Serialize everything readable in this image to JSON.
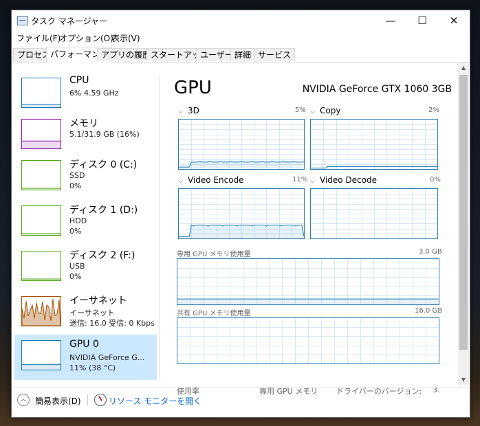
{
  "window": {
    "title": "タスク マネージャー",
    "minimize_glyph": "—",
    "maximize_glyph": "☐",
    "close_glyph": "✕"
  },
  "menu": [
    "ファイル(F)",
    "オプション(O)",
    "表示(V)"
  ],
  "tabs": [
    {
      "label": "プロセス"
    },
    {
      "label": "パフォーマンス",
      "active": true
    },
    {
      "label": "アプリの履歴"
    },
    {
      "label": "スタートアップ"
    },
    {
      "label": "ユーザー"
    },
    {
      "label": "詳細"
    },
    {
      "label": "サービス"
    }
  ],
  "sidebar": [
    {
      "name": "CPU",
      "line1": "6% 4.59 GHz",
      "color": "#1179b8",
      "level": 0.06
    },
    {
      "name": "メモリ",
      "line1": "5.1/31.9 GB (16%)",
      "color": "#8b12ae",
      "level": 0.16
    },
    {
      "name": "ディスク 0 (C:)",
      "line1": "SSD",
      "line2": "0%",
      "color": "#4da60c",
      "level": 0
    },
    {
      "name": "ディスク 1 (D:)",
      "line1": "HDD",
      "line2": "0%",
      "color": "#4da60c",
      "level": 0
    },
    {
      "name": "ディスク 2 (F:)",
      "line1": "USB",
      "line2": "0%",
      "color": "#4da60c",
      "level": 0
    },
    {
      "name": "イーサネット",
      "line1": "イーサネット",
      "line2": "送信: 16.0 受信: 0 Kbps",
      "color": "#a74f01"
    },
    {
      "name": "GPU 0",
      "line1": "NVIDIA GeForce G...",
      "line2": "11% (38 °C)",
      "color": "#1179b8",
      "level": 0.11,
      "selected": true
    }
  ],
  "main": {
    "title": "GPU",
    "model": "NVIDIA GeForce GTX 1060 3GB",
    "engines": [
      {
        "label": "3D",
        "pct": "5%"
      },
      {
        "label": "Copy",
        "pct": "2%"
      },
      {
        "label": "Video Encode",
        "pct": "11%"
      },
      {
        "label": "Video Decode",
        "pct": "0%"
      }
    ],
    "dedicated_label": "専用 GPU メモリ使用量",
    "dedicated_max": "3.0 GB",
    "shared_label": "共有 GPU メモリ使用量",
    "shared_max": "16.0 GB",
    "bottom_stats": [
      "使用率",
      "専用 GPU メモリ",
      "ドライバーのバージョン:",
      "3."
    ]
  },
  "footer": {
    "fewer_details": "簡易表示(D)",
    "resource_monitor": "リソース モニターを開く"
  },
  "colors": {
    "accent": "#1179b8",
    "grid": "#d6e8f4",
    "selected": "#cce8ff"
  }
}
